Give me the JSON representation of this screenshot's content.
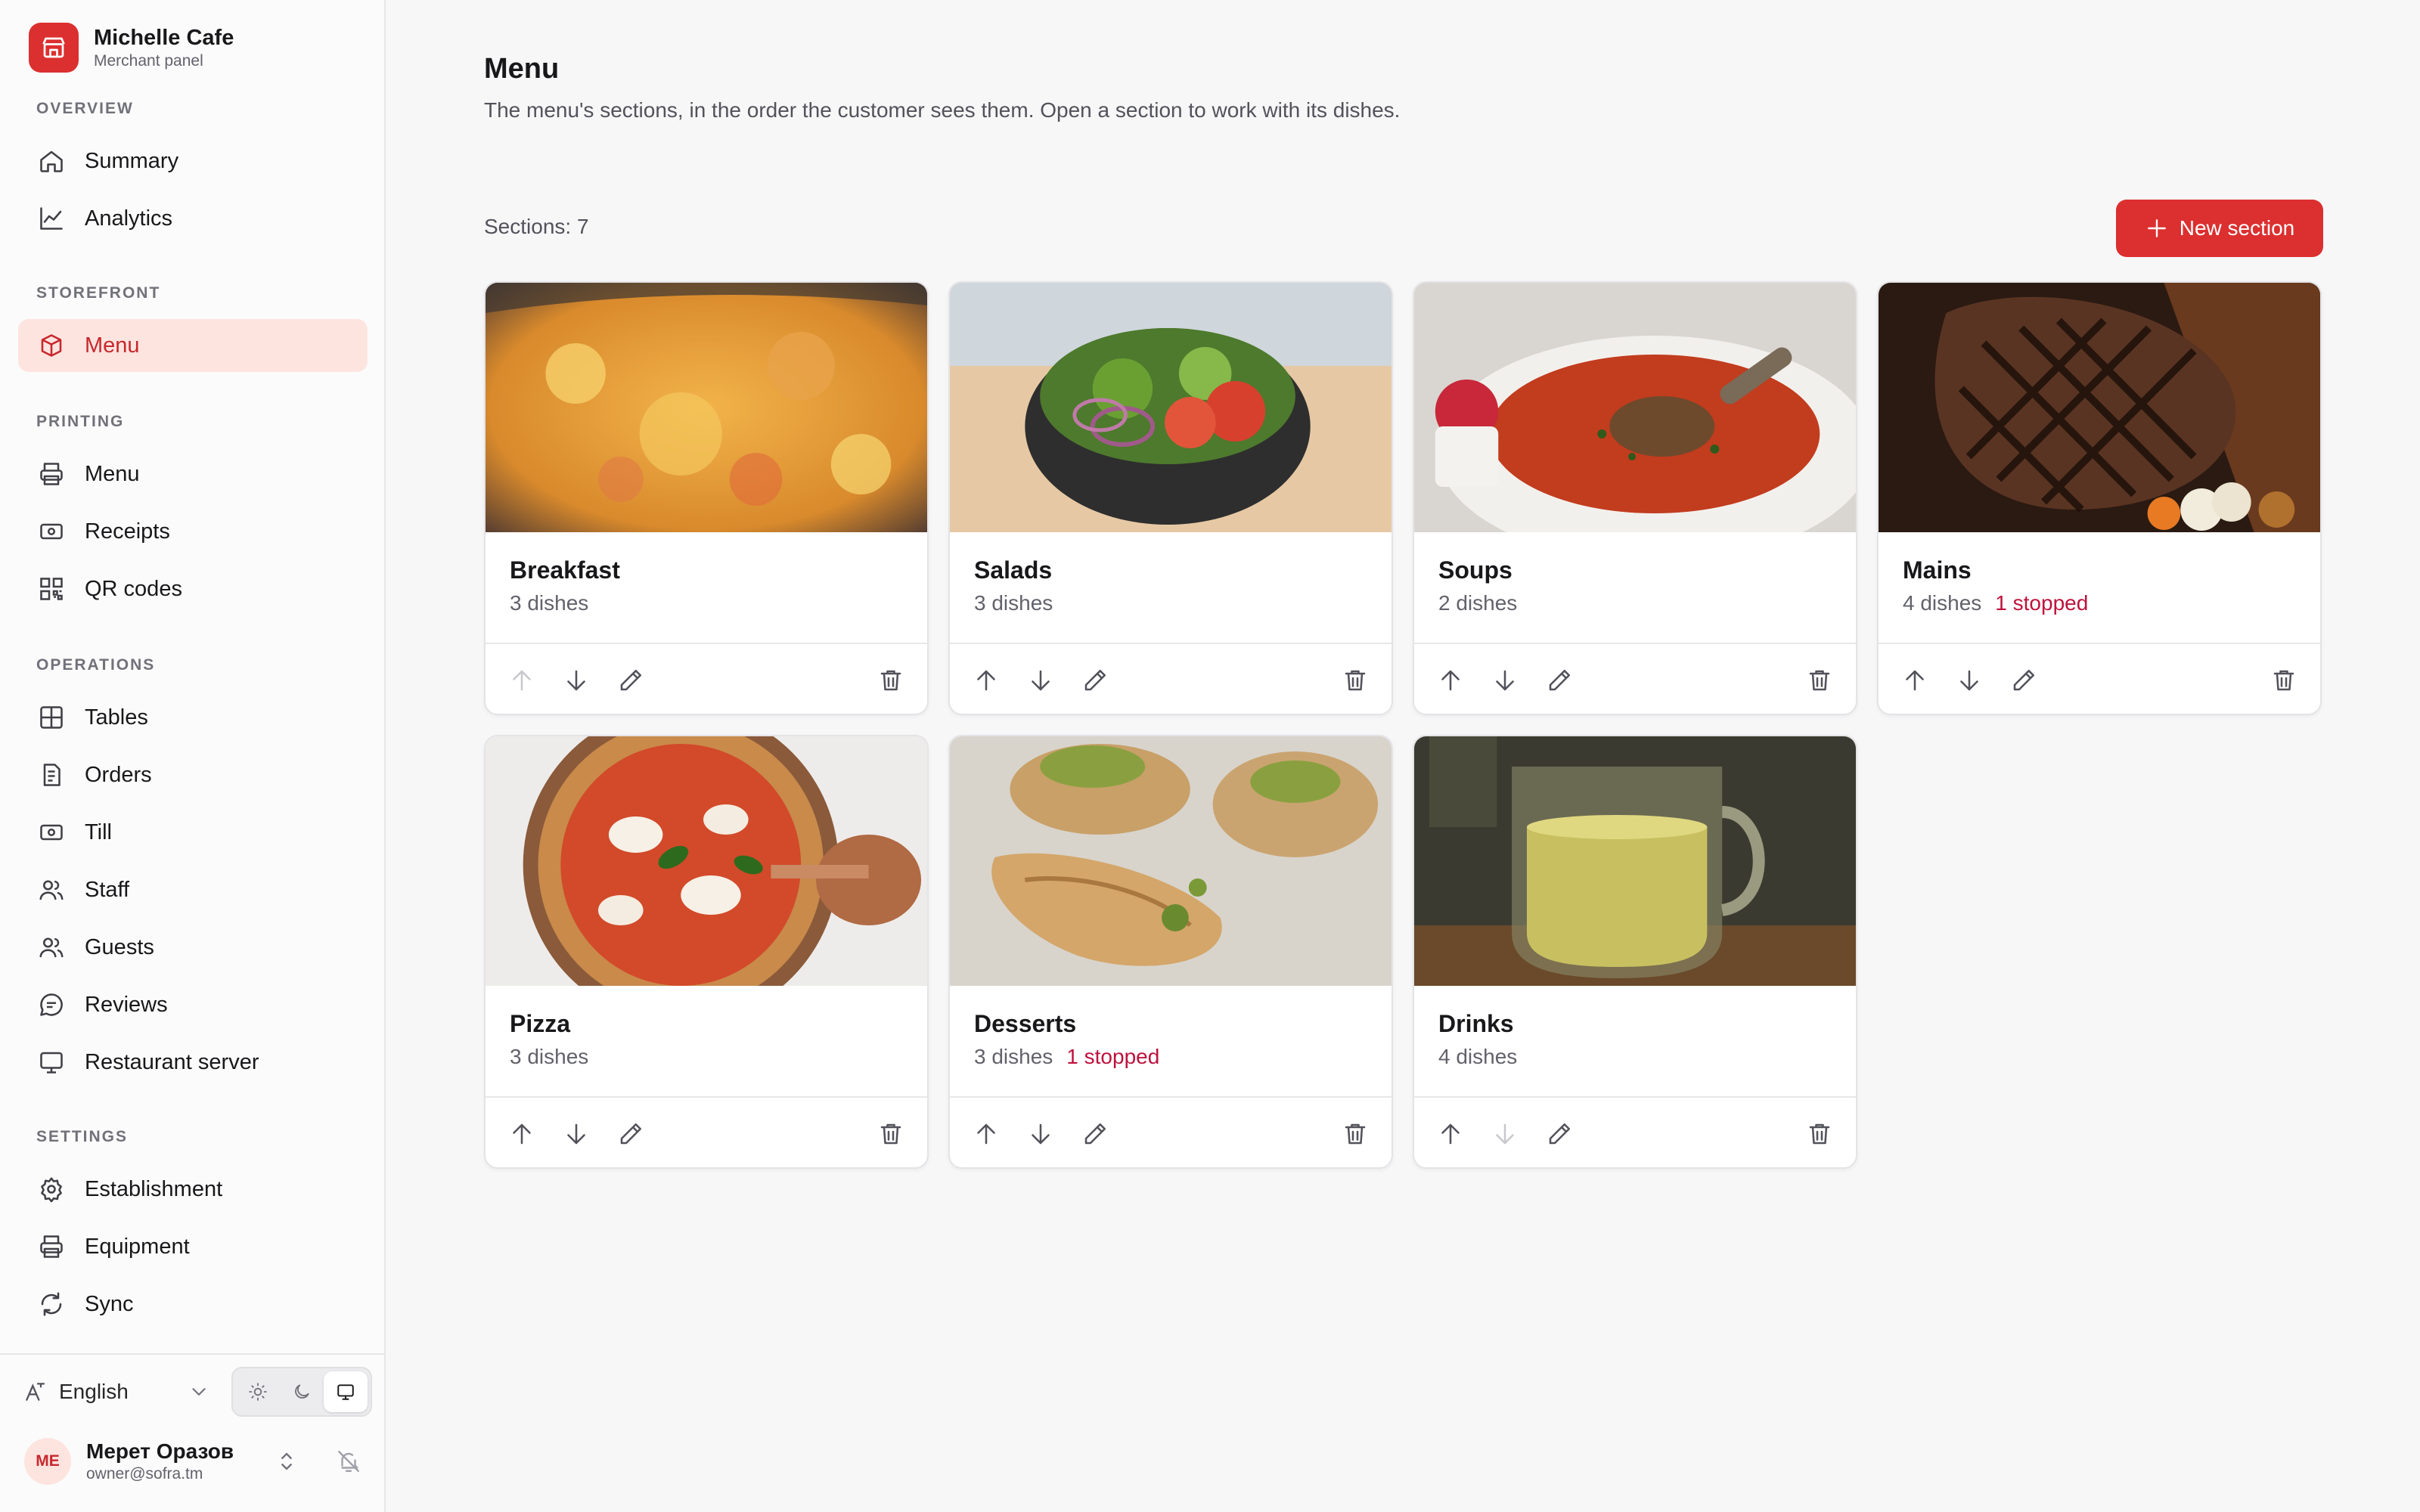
{
  "brand": {
    "title": "Michelle Cafe",
    "subtitle": "Merchant panel"
  },
  "sidebar": {
    "groups": [
      {
        "label": "OVERVIEW",
        "items": [
          {
            "label": "Summary",
            "icon": "home-icon"
          },
          {
            "label": "Analytics",
            "icon": "chart-line-icon"
          }
        ]
      },
      {
        "label": "STOREFRONT",
        "items": [
          {
            "label": "Menu",
            "icon": "box-stack-icon",
            "active": true
          }
        ]
      },
      {
        "label": "PRINTING",
        "items": [
          {
            "label": "Menu",
            "icon": "printer-icon"
          },
          {
            "label": "Receipts",
            "icon": "receipt-icon"
          },
          {
            "label": "QR codes",
            "icon": "qr-code-icon"
          }
        ]
      },
      {
        "label": "OPERATIONS",
        "items": [
          {
            "label": "Tables",
            "icon": "grid-icon"
          },
          {
            "label": "Orders",
            "icon": "document-icon"
          },
          {
            "label": "Till",
            "icon": "cash-icon"
          },
          {
            "label": "Staff",
            "icon": "users-icon"
          },
          {
            "label": "Guests",
            "icon": "guests-icon"
          },
          {
            "label": "Reviews",
            "icon": "chat-icon"
          },
          {
            "label": "Restaurant server",
            "icon": "monitor-icon"
          }
        ]
      },
      {
        "label": "SETTINGS",
        "items": [
          {
            "label": "Establishment",
            "icon": "gear-icon"
          },
          {
            "label": "Equipment",
            "icon": "printer-icon"
          },
          {
            "label": "Sync",
            "icon": "sync-icon"
          }
        ]
      }
    ],
    "language": "English",
    "theme_options": [
      "light",
      "dark",
      "system"
    ],
    "theme_selected": "system",
    "user": {
      "initials": "ME",
      "name": "Мерет Оразов",
      "email": "owner@sofra.tm"
    }
  },
  "main": {
    "title": "Menu",
    "description": "The menu's sections, in the order the customer sees them. Open a section to work with its dishes.",
    "count_label": "Sections: 7",
    "new_button": "New section",
    "sections": [
      {
        "name": "Breakfast",
        "dishes": "3 dishes",
        "stopped": "",
        "image": "scrambled-eggs-photo",
        "up_disabled": true,
        "down_disabled": false
      },
      {
        "name": "Salads",
        "dishes": "3 dishes",
        "stopped": "",
        "image": "salad-bowl-photo",
        "up_disabled": false,
        "down_disabled": false
      },
      {
        "name": "Soups",
        "dishes": "2 dishes",
        "stopped": "",
        "image": "soup-bowl-photo",
        "up_disabled": false,
        "down_disabled": false
      },
      {
        "name": "Mains",
        "dishes": "4 dishes",
        "stopped": "1 stopped",
        "image": "grilled-steak-photo",
        "up_disabled": false,
        "down_disabled": false
      },
      {
        "name": "Pizza",
        "dishes": "3 dishes",
        "stopped": "",
        "image": "pizza-photo",
        "up_disabled": false,
        "down_disabled": false
      },
      {
        "name": "Desserts",
        "dishes": "3 dishes",
        "stopped": "1 stopped",
        "image": "baklava-photo",
        "up_disabled": false,
        "down_disabled": false
      },
      {
        "name": "Drinks",
        "dishes": "4 dishes",
        "stopped": "",
        "image": "green-tea-photo",
        "up_disabled": false,
        "down_disabled": true
      }
    ]
  },
  "colors": {
    "accent": "#dc2f2f",
    "active_bg": "#fde4df",
    "active_text": "#c7282d",
    "stopped": "#be123c"
  }
}
